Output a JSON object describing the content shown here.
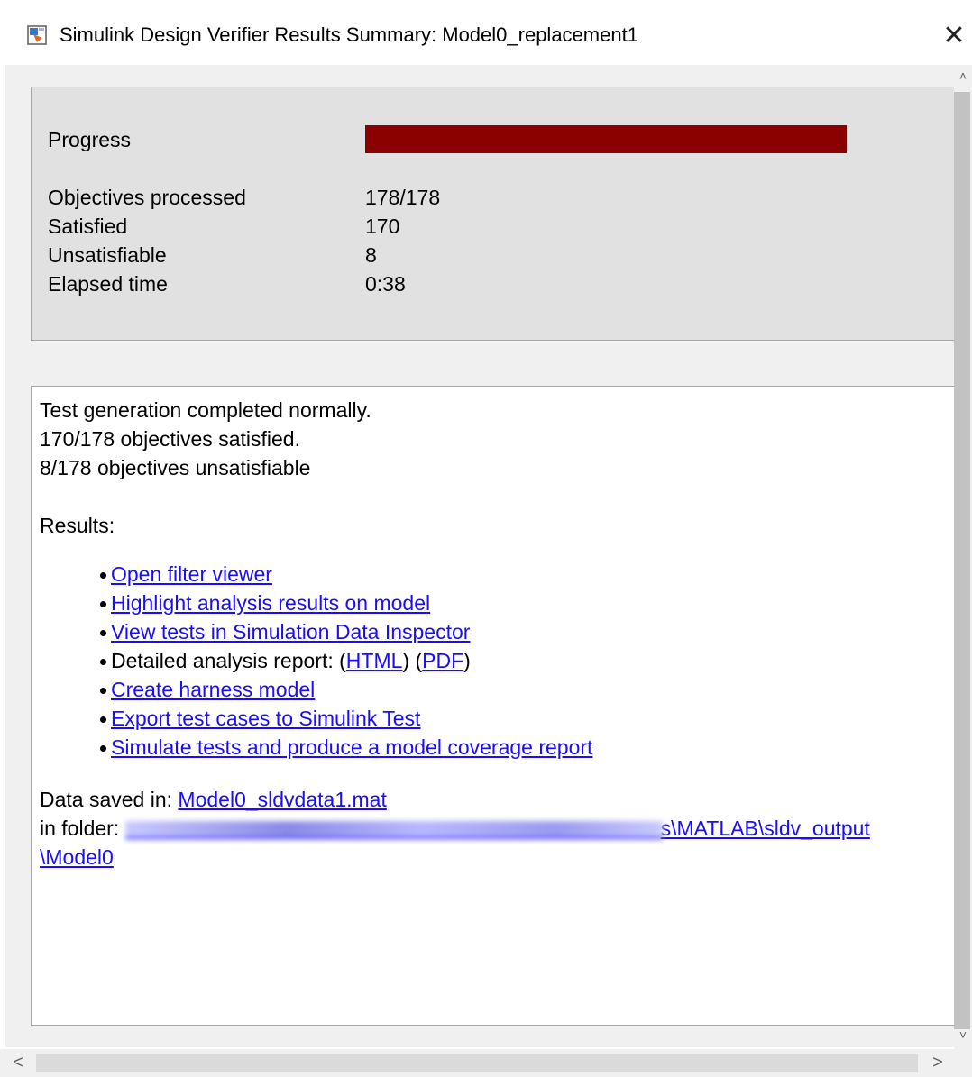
{
  "window": {
    "title": "Simulink Design Verifier Results Summary: Model0_replacement1",
    "close_glyph": "✕",
    "icon": "simulink-app-icon"
  },
  "progress_panel": {
    "progress_label": "Progress",
    "progress_fraction": 1.0,
    "progress_color": "#8b0000",
    "rows": [
      {
        "label": "Objectives processed",
        "value": "178/178"
      },
      {
        "label": "Satisfied",
        "value": "170"
      },
      {
        "label": "Unsatisfiable",
        "value": "8"
      },
      {
        "label": "Elapsed time",
        "value": "0:38"
      }
    ]
  },
  "results": {
    "line1": "Test generation completed normally.",
    "line2": "170/178 objectives satisfied.",
    "line3": "8/178 objectives unsatisfiable",
    "heading": "Results:",
    "links": {
      "open_filter_viewer": "Open filter viewer",
      "highlight_results": "Highlight analysis results on model",
      "view_tests_sdi": "View tests in Simulation Data Inspector",
      "report_prefix": "Detailed analysis report: (",
      "report_html": "HTML",
      "report_mid": ") (",
      "report_pdf": "PDF",
      "report_suffix": ")",
      "create_harness": "Create harness model",
      "export_test_cases": "Export test cases to Simulink Test",
      "simulate_tests": "Simulate tests and produce a model coverage report"
    },
    "data_saved_label": "Data saved in: ",
    "data_file": "Model0_sldvdata1.mat",
    "folder_label": "in folder: ",
    "folder_path_visible": "s\\MATLAB\\sldv_output",
    "folder_path_line2": "\\Model0"
  },
  "scrollbars": {
    "up_glyph": "˄",
    "down_glyph": "˅",
    "left_glyph": "<",
    "right_glyph": ">"
  },
  "colors": {
    "link": "#1a0dff",
    "panel_bg": "#e1e1e1",
    "progress_fill": "#8b0000"
  }
}
